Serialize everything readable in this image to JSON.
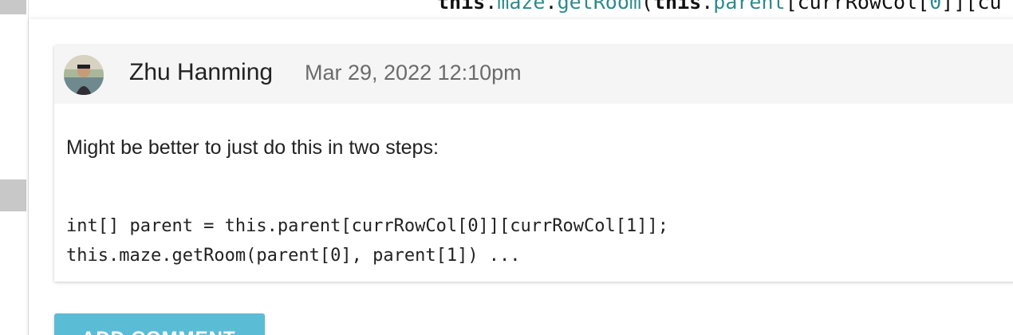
{
  "code_context": {
    "tokens": [
      {
        "text": "this",
        "kind": "kw"
      },
      {
        "text": ".",
        "kind": "plain"
      },
      {
        "text": "maze",
        "kind": "fld"
      },
      {
        "text": ".",
        "kind": "plain"
      },
      {
        "text": "getRoom",
        "kind": "fld"
      },
      {
        "text": "(",
        "kind": "plain"
      },
      {
        "text": "this",
        "kind": "kw"
      },
      {
        "text": ".",
        "kind": "plain"
      },
      {
        "text": "parent",
        "kind": "fld"
      },
      {
        "text": "[currRowCol[",
        "kind": "plain"
      },
      {
        "text": "0",
        "kind": "fld"
      },
      {
        "text": "]][cu",
        "kind": "plain"
      }
    ]
  },
  "comment": {
    "author": "Zhu Hanming",
    "timestamp": "Mar 29, 2022 12:10pm",
    "text": "Might be better to just do this in two steps:",
    "code_lines": [
      "int[] parent = this.parent[currRowCol[0]][currRowCol[1]];",
      "this.maze.getRoom(parent[0], parent[1]) ..."
    ]
  },
  "actions": {
    "add_comment_label": "ADD COMMENT"
  },
  "colors": {
    "accent": "#5bbcd6",
    "code_highlight": "#2d8a8a",
    "header_bg": "#f5f5f5"
  }
}
